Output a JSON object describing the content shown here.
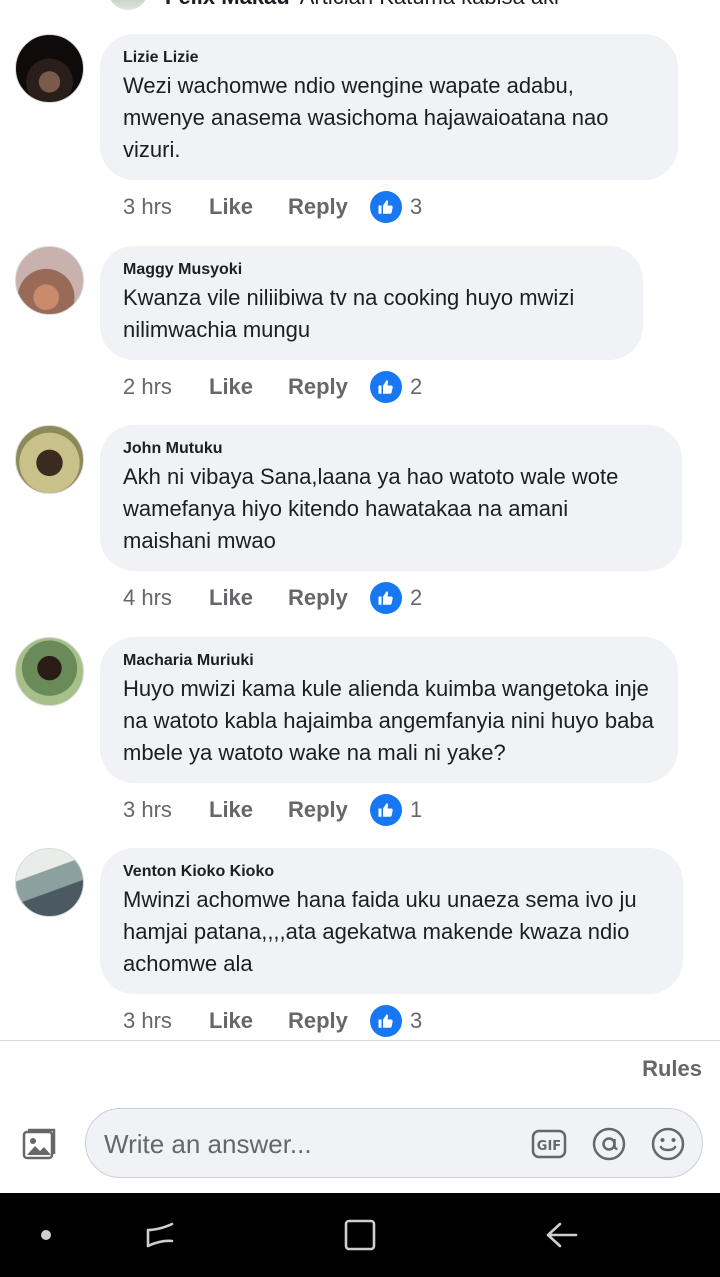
{
  "top_comment": {
    "author": "Felix Makau",
    "text": "Articlan Katuma kabisa aki"
  },
  "comments": [
    {
      "author": "Lizie Lizie",
      "text": "Wezi wachomwe ndio wengine wapate adabu, mwenye anasema wasichoma hajawaioatana nao vizuri.",
      "time": "3 hrs",
      "like": "Like",
      "reply": "Reply",
      "reactions": "3"
    },
    {
      "author": "Maggy Musyoki",
      "text": "Kwanza vile niliibiwa tv na cooking huyo mwizi nilimwachia mungu",
      "time": "2 hrs",
      "like": "Like",
      "reply": "Reply",
      "reactions": "2"
    },
    {
      "author": "John Mutuku",
      "text": "Akh ni vibaya Sana,laana ya hao watoto wale wote wamefanya hiyo kitendo hawatakaa na amani maishani mwao",
      "time": "4 hrs",
      "like": "Like",
      "reply": "Reply",
      "reactions": "2"
    },
    {
      "author": "Macharia Muriuki",
      "text": "Huyo mwizi kama kule aliendа kuimba wangetoka inje na watoto kabla hajaimba angemfanyia nini huyo baba mbele ya watoto wake na mali ni yake?",
      "time": "3 hrs",
      "like": "Like",
      "reply": "Reply",
      "reactions": "1"
    },
    {
      "author": "Venton Kioko Kioko",
      "text": "Mwinzi achomwe hana faida uku unaeza sema ivo ju hamjai patana,,,,ata agekatwa makende kwaza ndio achomwe ala",
      "time": "3 hrs",
      "like": "Like",
      "reply": "Reply",
      "reactions": "3"
    }
  ],
  "rules_label": "Rules",
  "composer": {
    "placeholder": "Write an answer..."
  },
  "icons": {
    "photo": "photo-icon",
    "gif": "gif-icon",
    "mention": "at-icon",
    "emoji": "emoji-icon",
    "reaction": "thumbs-up-icon"
  },
  "colors": {
    "accent": "#1877f2",
    "bubble": "#f0f2f5",
    "meta": "#65676b",
    "navbar": "#000000"
  }
}
